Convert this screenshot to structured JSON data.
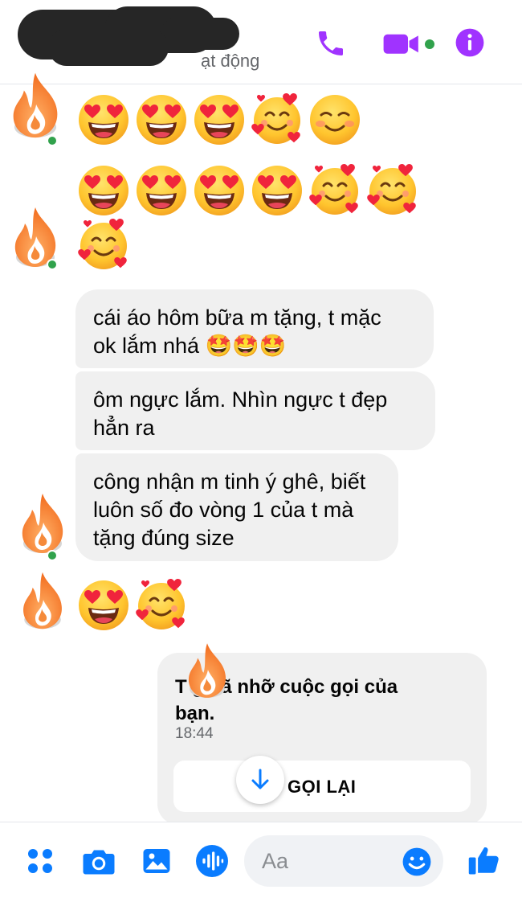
{
  "header": {
    "status_text": "ạt động",
    "icons": {
      "call": "phone-icon",
      "video": "video-camera-icon",
      "info": "info-icon"
    },
    "accent_color": "#a033ff"
  },
  "messages": {
    "emoji_row_1": [
      "heart-eyes",
      "heart-eyes",
      "heart-eyes",
      "smiling-hearts",
      "blushing-smile"
    ],
    "emoji_row_2": [
      "heart-eyes",
      "heart-eyes",
      "heart-eyes",
      "heart-eyes",
      "smiling-hearts",
      "smiling-hearts"
    ],
    "emoji_row_3": [
      "smiling-hearts"
    ],
    "bubble_1": {
      "line1": "cái áo hôm bữa m tặng, t mặc",
      "line2": "ok lắm nhá 🤩🤩🤩"
    },
    "bubble_2": {
      "line1": "ôm ngực lắm. Nhìn ngực t đẹp",
      "line2": "hẳn ra"
    },
    "bubble_3": {
      "line1": "công nhận m tinh ý ghê, biết",
      "line2": "luôn số đo vòng 1 của t mà",
      "line3": "tặng đúng size"
    },
    "emoji_row_4": [
      "heart-eyes",
      "smiling-hearts"
    ]
  },
  "call_card": {
    "line1": "T     g đã nhỡ cuộc gọi của",
    "line2": "bạn.",
    "time": "18:44",
    "callback_label": "GỌI LẠI"
  },
  "composer": {
    "placeholder": "Aa",
    "icons": [
      "menu-dots-icon",
      "camera-icon",
      "image-icon",
      "voice-icon",
      "emoji-icon",
      "like-icon"
    ],
    "accent_color": "#0a7cff"
  }
}
